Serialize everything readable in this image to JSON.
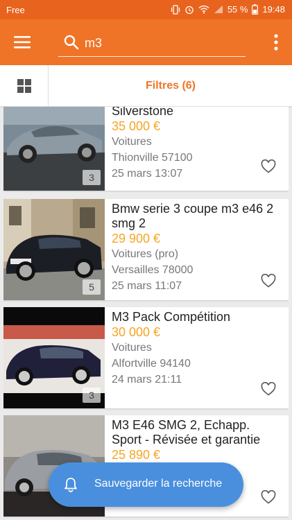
{
  "status_bar": {
    "carrier": "Free",
    "battery": "55 %",
    "time": "19:48"
  },
  "search": {
    "query": "m3"
  },
  "filters": {
    "label": "Filtres (6)"
  },
  "listings": [
    {
      "title": "Silverstone",
      "price": "35 000 €",
      "category": "Voitures",
      "location": "Thionville 57100",
      "date": "25 mars 13:07",
      "photo_count": "3"
    },
    {
      "title": "Bmw serie 3 coupe m3 e46 2 smg 2",
      "price": "29 900 €",
      "category": "Voitures (pro)",
      "location": "Versailles 78000",
      "date": "25 mars 11:07",
      "photo_count": "5"
    },
    {
      "title": "M3 Pack Compétition",
      "price": "30 000 €",
      "category": "Voitures",
      "location": "Alfortville 94140",
      "date": "24 mars 21:11",
      "photo_count": "3"
    },
    {
      "title": "M3 E46 SMG 2, Echapp. Sport - Révisée et garantie",
      "price": "25 890 €",
      "category": "",
      "location": "",
      "date": "",
      "photo_count": ""
    }
  ],
  "save_search": {
    "label": "Sauvegarder la recherche"
  },
  "colors": {
    "brand": "#f07427",
    "price": "#f5a623",
    "fab": "#4a8fde"
  }
}
